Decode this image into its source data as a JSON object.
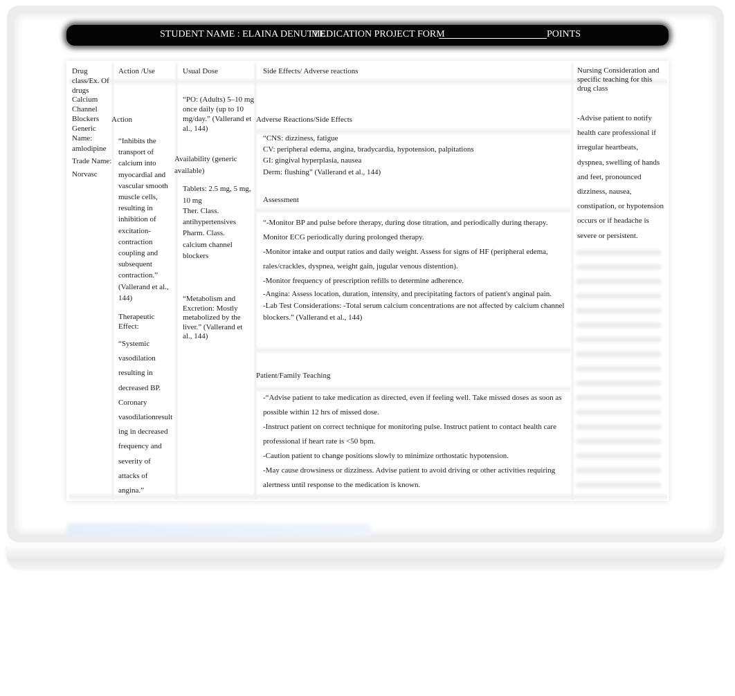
{
  "header": {
    "student_label": "STUDENT NAME : ELAINA DENUTTE",
    "form_title": "MEDICATION PROJECT FORM",
    "points_label": "POINTS"
  },
  "columns": {
    "drug_class": "Drug class/Ex. Of drugs",
    "action_use": "Action /Use",
    "usual_dose": "Usual Dose",
    "side_effects": "Side Effects/ Adverse reactions",
    "nursing": "Nursing Consideration and specific teaching for this drug class"
  },
  "drug": {
    "class_lines": [
      "Calcium",
      "Channel",
      "Blockers"
    ],
    "generic_label": "Generic Name:",
    "generic_name": "amlodipine",
    "trade_label": "Trade Name:",
    "trade_name": "Norvasc"
  },
  "action": {
    "section_label": "Action",
    "text_lines": [
      "“Inhibits the",
      "transport of",
      "calcium into",
      "myocardial and",
      "vascular smooth",
      "muscle cells,",
      "resulting in",
      "inhibition of",
      "excitation-",
      "contraction",
      "coupling and",
      "subsequent",
      "contraction.”",
      "(Vallerand et al.,",
      "144)"
    ],
    "therapeutic_label": "Therapeutic Effect:",
    "therapeutic_lines": [
      "“Systemic",
      "vasodilation",
      "resulting in",
      "decreased BP.",
      "Coronary",
      "vasodilationresult",
      "ing in decreased",
      "frequency and",
      "severity of",
      "attacks of",
      "angina.”"
    ]
  },
  "dose": {
    "usual": "“PO: (Adults) 5–10 mg once daily (up to 10 mg/day.” (Vallerand et al., 144)",
    "availability_label": "Availability (generic available)",
    "tablets": "Tablets: 2.5 mg, 5 mg, 10 mg",
    "ther_class_label": "Ther. Class.",
    "ther_class": "antihypertensives",
    "pharm_class_label": "Pharm. Class.",
    "pharm_class": "calcium channel blockers",
    "metabolism": "“Metabolism and Excretion: Mostly metabolized by the liver.” (Vallerand et al., 144)"
  },
  "side_effects": {
    "section_label": "Adverse Reactions/Side Effects",
    "lines": [
      "“CNS: dizziness, fatigue",
      "CV: peripheral edema, angina, bradycardia, hypotension, palpitations",
      "GI: gingival hyperplasia, nausea",
      "Derm: flushing” (Vallerand et al., 144)"
    ]
  },
  "assessment": {
    "section_label": "Assessment",
    "lines": [
      "“-Monitor BP and pulse before therapy, during dose titration, and periodically during therapy.",
      "Monitor ECG periodically during prolonged therapy.",
      "-Monitor intake and output ratios and daily weight. Assess for signs of HF (peripheral edema,",
      "rales/crackles, dyspnea, weight gain, jugular venous distention).",
      "-Monitor frequency of prescription refills to determine adherence.",
      "-Angina: Assess location, duration, intensity, and precipitating factors of patient's anginal pain.",
      "-Lab Test Considerations: -Total serum calcium concentrations are not affected by calcium channel",
      "blockers.” (Vallerand et al., 144)"
    ]
  },
  "teaching": {
    "section_label": "Patient/Family Teaching",
    "lines": [
      "-“Advise patient to take medication as directed, even if feeling well. Take missed doses as soon as",
      "possible within 12 hrs of missed dose.",
      "-Instruct patient on correct technique for monitoring pulse. Instruct patient to contact health care",
      "professional if heart rate is <50 bpm.",
      "-Caution patient to change positions slowly to minimize orthostatic hypotension.",
      "-May cause drowsiness or dizziness. Advise patient to avoid driving or other activities requiring",
      "alertness until response to the medication is known."
    ]
  },
  "nursing": {
    "lines": [
      "-Advise patient to notify",
      "health care professional if",
      "irregular heartbeats,",
      "dyspnea, swelling of hands",
      "and feet, pronounced",
      "dizziness, nausea,",
      "constipation, or hypotension",
      "occurs or if headache is",
      "severe or persistent."
    ]
  }
}
